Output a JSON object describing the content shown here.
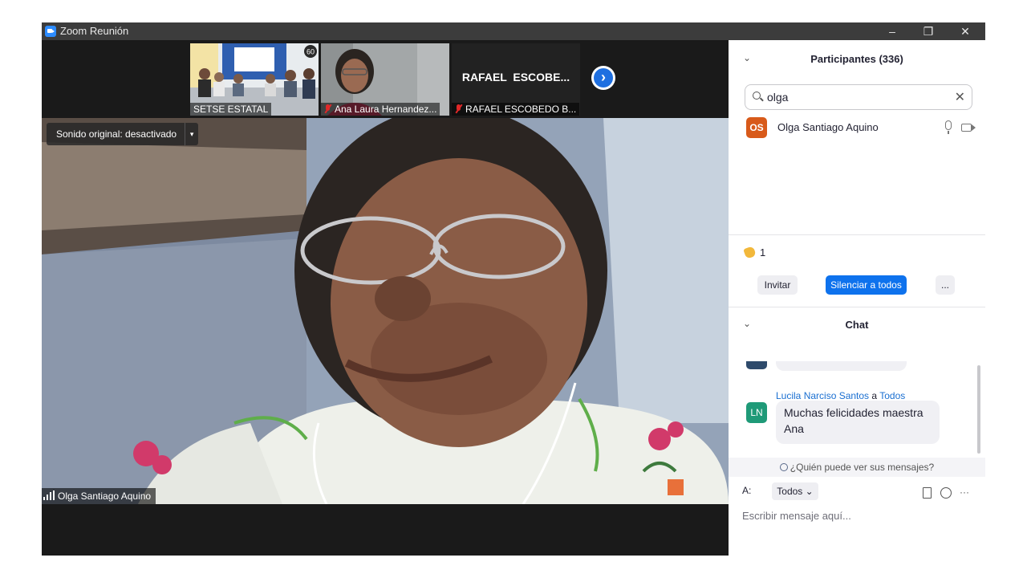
{
  "window": {
    "title": "Zoom Reunión",
    "minimize": "–",
    "restore": "❐",
    "close": "✕"
  },
  "strip": {
    "tiles": [
      {
        "name": "SETSE ESTATAL",
        "badge": "60"
      },
      {
        "name": "Ana Laura Hernandez...",
        "muted": true
      },
      {
        "name": "RAFAEL ESCOBEDO B...",
        "label": "RAFAEL  ESCOBE...",
        "muted": true
      }
    ],
    "next_arrow": "›"
  },
  "main_video": {
    "sound_label": "Sonido original: desactivado",
    "sound_dropdown": "▾",
    "speaker_name": "Olga Santiago Aquino"
  },
  "participants": {
    "header": "Participantes (336)",
    "collapse": "⌄",
    "search_value": "olga",
    "clear": "✕",
    "list": [
      {
        "initials": "OS",
        "name": "Olga Santiago Aquino",
        "avatar_color": "#d85a1a"
      }
    ],
    "clap_count": "1",
    "invite_label": "Invitar",
    "mute_all_label": "Silenciar a todos",
    "more_label": "..."
  },
  "chat": {
    "header": "Chat",
    "collapse": "⌄",
    "message": {
      "initials": "LN",
      "avatar_color": "#1f9a78",
      "sender": "Lucila Narciso Santos",
      "to_word": "a",
      "recipient": "Todos",
      "line1": "Muchas felicidades maestra",
      "line2": "Ana"
    },
    "who_can_see": "¿Quién puede ver sus mensajes?",
    "to_label": "A:",
    "to_value": "Todos ⌄",
    "more_icon": "···",
    "placeholder": "Escribir mensaje aquí..."
  },
  "colors": {
    "accent": "#0e72ed",
    "link": "#1a6fd1"
  }
}
